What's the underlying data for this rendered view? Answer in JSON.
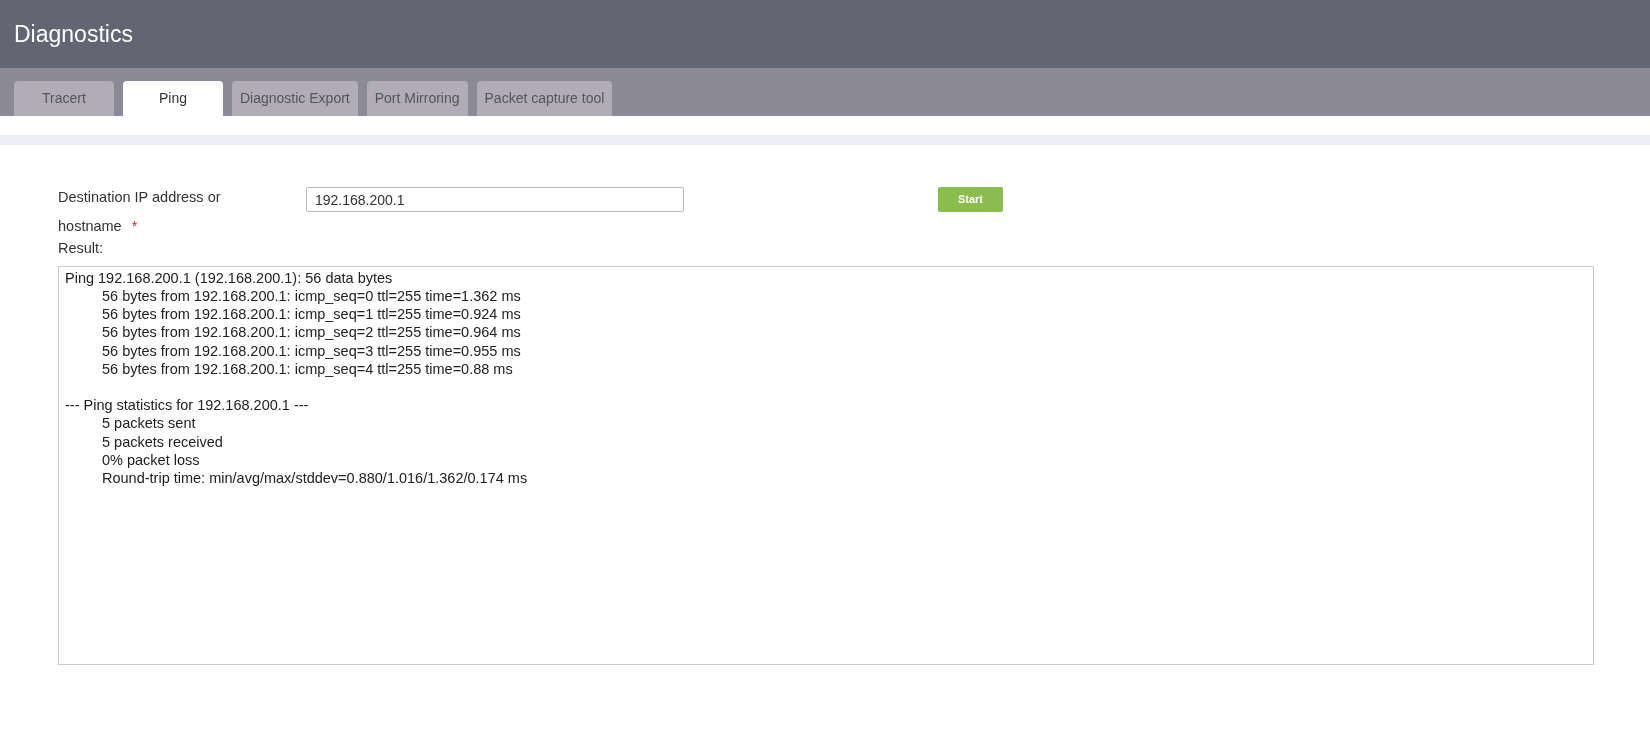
{
  "page_title": "Diagnostics",
  "tabs": [
    {
      "label": "Tracert",
      "selected": false
    },
    {
      "label": "Ping",
      "selected": true
    },
    {
      "label": "Diagnostic Export",
      "selected": false
    },
    {
      "label": "Port Mirroring",
      "selected": false
    },
    {
      "label": "Packet capture tool",
      "selected": false
    }
  ],
  "destination": {
    "label_lines": [
      "Destination IP address or",
      "hostname"
    ],
    "required_mark": "*",
    "value": "192.168.200.1"
  },
  "start_button": "Start",
  "result": {
    "label": "Result:",
    "lines": [
      {
        "text": "Ping 192.168.200.1 (192.168.200.1): 56 data bytes",
        "children": [
          {
            "text": "56 bytes from 192.168.200.1: icmp_seq=0 ttl=255 time=1.362 ms"
          },
          {
            "text": "56 bytes from 192.168.200.1: icmp_seq=1 ttl=255 time=0.924 ms"
          },
          {
            "text": "56 bytes from 192.168.200.1: icmp_seq=2 ttl=255 time=0.964 ms"
          },
          {
            "text": "56 bytes from 192.168.200.1: icmp_seq=3 ttl=255 time=0.955 ms"
          },
          {
            "text": "56 bytes from 192.168.200.1: icmp_seq=4 ttl=255 time=0.88 ms"
          }
        ]
      },
      {
        "text": "--- Ping statistics for 192.168.200.1 ---",
        "children": [
          {
            "text": "5 packets sent"
          },
          {
            "text": "5 packets received"
          },
          {
            "text": "0% packet loss"
          },
          {
            "text": "Round-trip time: min/avg/max/stddev=0.880/1.016/1.362/0.174 ms"
          }
        ]
      }
    ]
  }
}
